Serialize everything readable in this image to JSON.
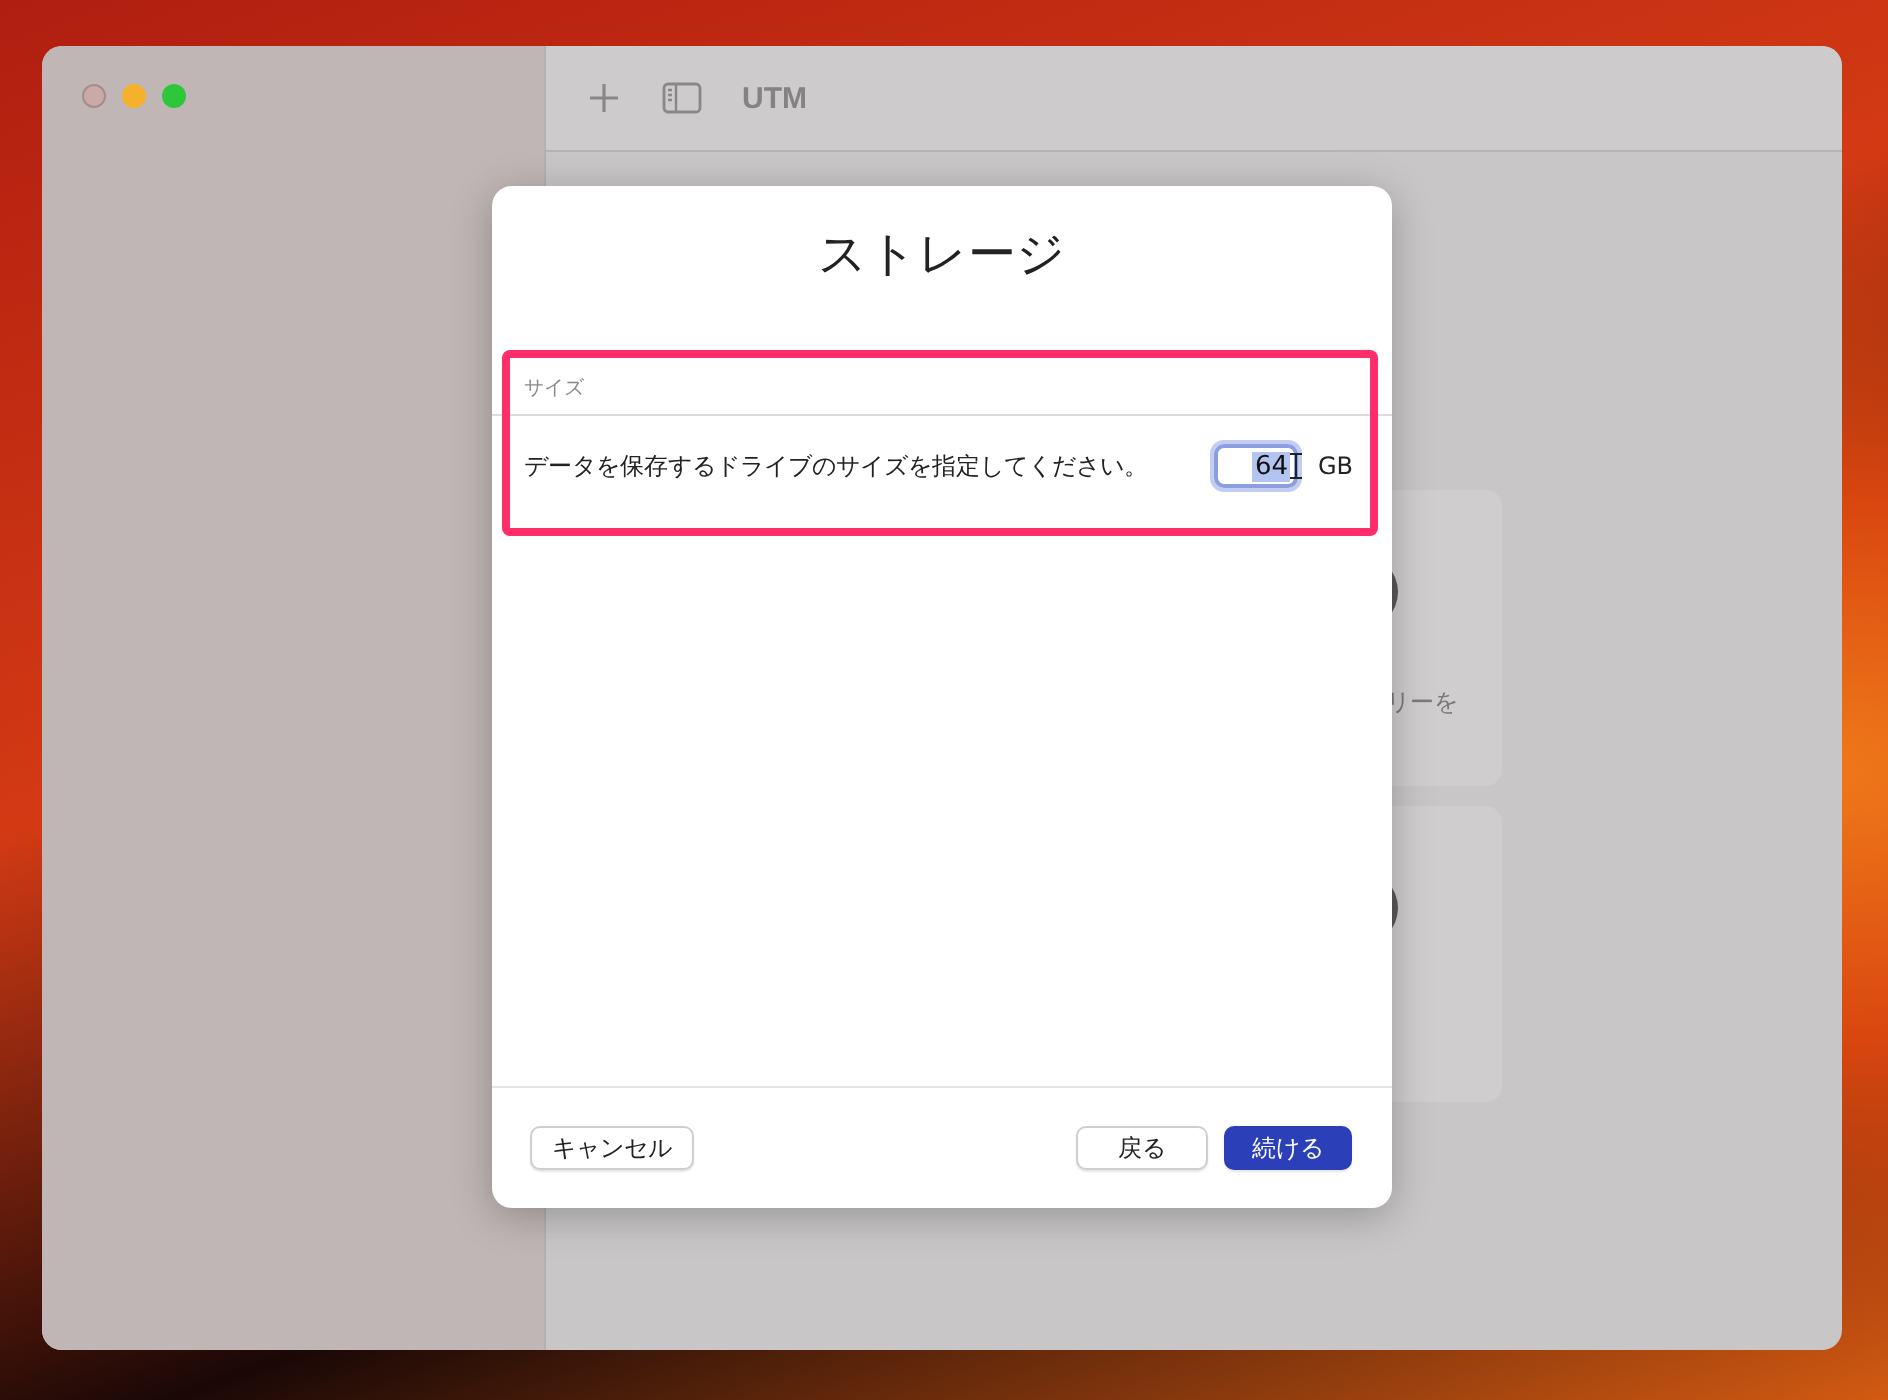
{
  "window": {
    "title": "UTM"
  },
  "background_card": {
    "text": "リーを"
  },
  "dialog": {
    "title": "ストレージ",
    "section": {
      "header": "サイズ",
      "description": "データを保存するドライブのサイズを指定してください。",
      "value": "64",
      "unit": "GB",
      "highlighted": true
    },
    "buttons": [
      {
        "label": "キャンセル",
        "kind": "secondary"
      },
      {
        "label": "戻る",
        "kind": "secondary"
      },
      {
        "label": "続ける",
        "kind": "primary"
      }
    ]
  }
}
